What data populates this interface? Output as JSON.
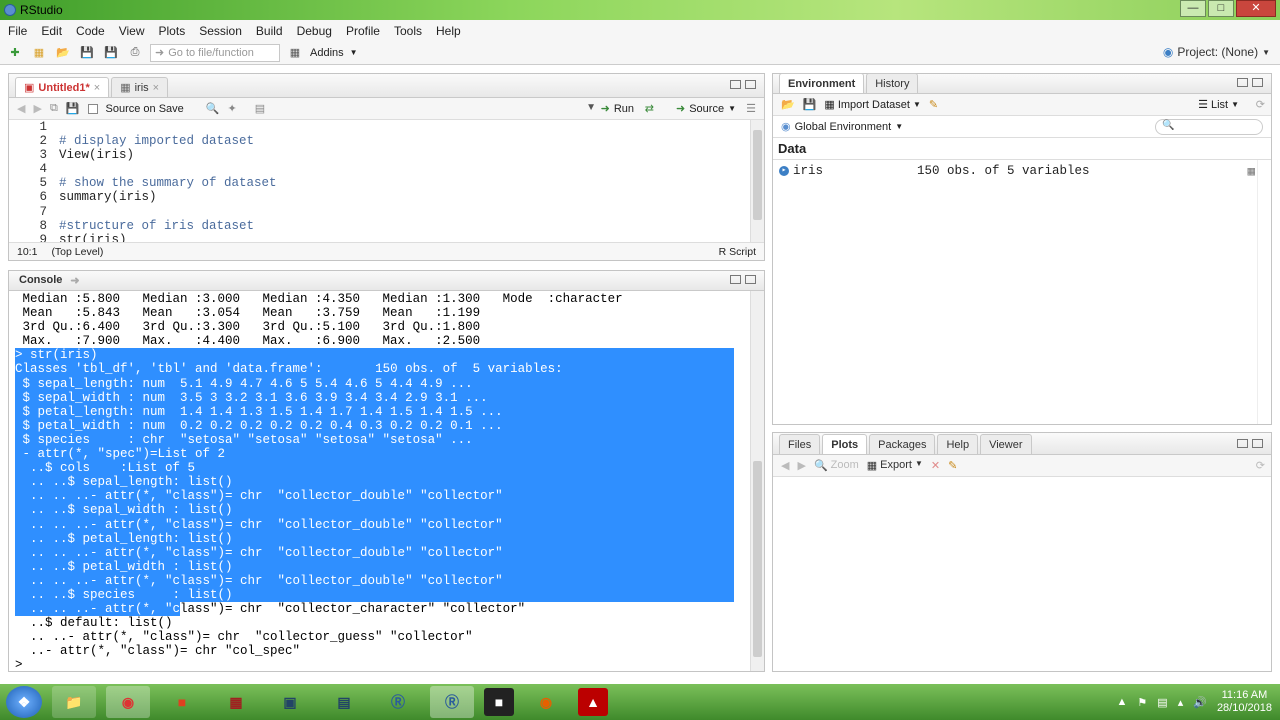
{
  "window": {
    "title": "RStudio"
  },
  "menu": [
    "File",
    "Edit",
    "Code",
    "View",
    "Plots",
    "Session",
    "Build",
    "Debug",
    "Profile",
    "Tools",
    "Help"
  ],
  "toolbar": {
    "goto_placeholder": "Go to file/function",
    "addins": "Addins",
    "project": "Project: (None)"
  },
  "editor": {
    "tabs": [
      {
        "label": "Untitled1*",
        "state": "unsaved"
      },
      {
        "label": "iris",
        "state": "normal"
      }
    ],
    "source_on_save": "Source on Save",
    "run": "Run",
    "source": "Source",
    "lines": [
      {
        "n": "1",
        "text": "",
        "type": "code"
      },
      {
        "n": "2",
        "text": "# display imported dataset",
        "type": "comment"
      },
      {
        "n": "3",
        "text": "View(iris)",
        "type": "code"
      },
      {
        "n": "4",
        "text": "",
        "type": "code"
      },
      {
        "n": "5",
        "text": "# show the summary of dataset",
        "type": "comment"
      },
      {
        "n": "6",
        "text": "summary(iris)",
        "type": "code"
      },
      {
        "n": "7",
        "text": "",
        "type": "code"
      },
      {
        "n": "8",
        "text": "#structure of iris dataset",
        "type": "comment"
      },
      {
        "n": "9",
        "text": "str(iris)",
        "type": "code"
      }
    ],
    "cursor": "10:1",
    "level": "(Top Level)",
    "filetype": "R Script"
  },
  "console": {
    "tab": "Console",
    "lines": [
      {
        "text": " Median :5.800   Median :3.000   Median :4.350   Median :1.300   Mode  :character",
        "sel": false
      },
      {
        "text": " Mean   :5.843   Mean   :3.054   Mean   :3.759   Mean   :1.199",
        "sel": false
      },
      {
        "text": " 3rd Qu.:6.400   3rd Qu.:3.300   3rd Qu.:5.100   3rd Qu.:1.800",
        "sel": false
      },
      {
        "text": " Max.   :7.900   Max.   :4.400   Max.   :6.900   Max.   :2.500",
        "sel": false
      },
      {
        "text": "> str(iris)",
        "sel": true
      },
      {
        "text": "Classes 'tbl_df', 'tbl' and 'data.frame':\t150 obs. of  5 variables:",
        "sel": true
      },
      {
        "text": " $ sepal_length: num  5.1 4.9 4.7 4.6 5 5.4 4.6 5 4.4 4.9 ...",
        "sel": true
      },
      {
        "text": " $ sepal_width : num  3.5 3 3.2 3.1 3.6 3.9 3.4 3.4 2.9 3.1 ...",
        "sel": true
      },
      {
        "text": " $ petal_length: num  1.4 1.4 1.3 1.5 1.4 1.7 1.4 1.5 1.4 1.5 ...",
        "sel": true
      },
      {
        "text": " $ petal_width : num  0.2 0.2 0.2 0.2 0.2 0.4 0.3 0.2 0.2 0.1 ...",
        "sel": true
      },
      {
        "text": " $ species     : chr  \"setosa\" \"setosa\" \"setosa\" \"setosa\" ...",
        "sel": true
      },
      {
        "text": " - attr(*, \"spec\")=List of 2",
        "sel": true
      },
      {
        "text": "  ..$ cols    :List of 5",
        "sel": true
      },
      {
        "text": "  .. ..$ sepal_length: list()",
        "sel": true
      },
      {
        "text": "  .. .. ..- attr(*, \"class\")= chr  \"collector_double\" \"collector\"",
        "sel": true
      },
      {
        "text": "  .. ..$ sepal_width : list()",
        "sel": true
      },
      {
        "text": "  .. .. ..- attr(*, \"class\")= chr  \"collector_double\" \"collector\"",
        "sel": true
      },
      {
        "text": "  .. ..$ petal_length: list()",
        "sel": true
      },
      {
        "text": "  .. .. ..- attr(*, \"class\")= chr  \"collector_double\" \"collector\"",
        "sel": true
      },
      {
        "text": "  .. ..$ petal_width : list()",
        "sel": true
      },
      {
        "text": "  .. .. ..- attr(*, \"class\")= chr  \"collector_double\" \"collector\"",
        "sel": true
      },
      {
        "text": "  .. ..$ species     : list()",
        "sel": true
      },
      {
        "text": "  .. .. ..- attr(*, \"class\")= chr  \"collector_character\" \"collector\"",
        "sel": "partial",
        "split": 22
      },
      {
        "text": "  ..$ default: list()",
        "sel": false
      },
      {
        "text": "  .. ..- attr(*, \"class\")= chr  \"collector_guess\" \"collector\"",
        "sel": false
      },
      {
        "text": "  ..- attr(*, \"class\")= chr \"col_spec\"",
        "sel": false
      },
      {
        "text": "> ",
        "sel": false
      }
    ]
  },
  "environment": {
    "tabs": [
      "Environment",
      "History"
    ],
    "import": "Import Dataset",
    "view": "List",
    "scope": "Global Environment",
    "section": "Data",
    "rows": [
      {
        "name": "iris",
        "value": "150 obs. of 5 variables"
      }
    ]
  },
  "files": {
    "tabs": [
      "Files",
      "Plots",
      "Packages",
      "Help",
      "Viewer"
    ],
    "zoom": "Zoom",
    "export": "Export"
  },
  "taskbar": {
    "time": "11:16 AM",
    "date": "28/10/2018"
  }
}
